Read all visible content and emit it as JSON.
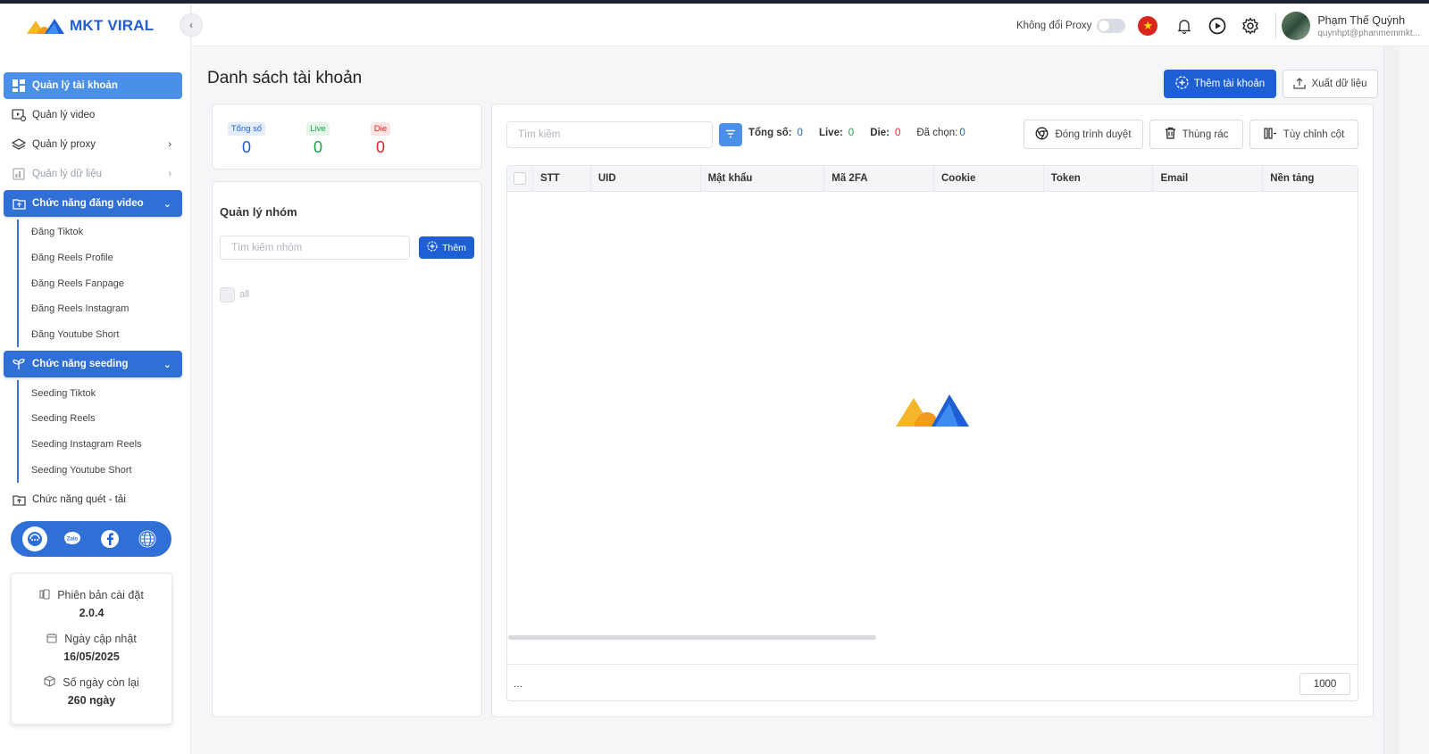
{
  "brand": {
    "name": "MKT VIRAL",
    "primary_color": "#1e5fd6",
    "accent_color": "#4a8fe8"
  },
  "header": {
    "proxy_label": "Không đổi Proxy",
    "user_name": "Phạm Thế Quỳnh",
    "user_email": "quynhpt@phanmemmkt..."
  },
  "sidebar": {
    "items": [
      {
        "label": "Quản lý tài khoản",
        "icon": "grid-icon"
      },
      {
        "label": "Quản lý video",
        "icon": "video-icon"
      },
      {
        "label": "Quản lý proxy",
        "icon": "layers-icon"
      },
      {
        "label": "Quản lý dữ liệu",
        "icon": "chart-icon"
      }
    ],
    "video_section": {
      "label": "Chức năng đăng video",
      "items": [
        "Đăng Tiktok",
        "Đăng Reels Profile",
        "Đăng Reels Fanpage",
        "Đăng Reels Instagram",
        "Đăng Youtube Short"
      ]
    },
    "seeding_section": {
      "label": "Chức năng seeding",
      "items": [
        "Seeding Tiktok",
        "Seeding Reels",
        "Seeding Instagram Reels",
        "Seeding Youtube Short"
      ]
    },
    "scan_label": "Chức năng quét - tải",
    "info": {
      "version_label": "Phiên bản cài đặt",
      "version_value": "2.0.4",
      "update_label": "Ngày cập nhật",
      "update_value": "16/05/2025",
      "days_label": "Số ngày còn lại",
      "days_value": "260 ngày"
    }
  },
  "main": {
    "title": "Danh sách tài khoản",
    "add_account_label": "Thêm tài khoản",
    "export_label": "Xuất dữ liệu",
    "stats": [
      {
        "label": "Tổng số",
        "value": "0",
        "color": "#1e5fd6"
      },
      {
        "label": "Live",
        "value": "0",
        "color": "#1aa34a"
      },
      {
        "label": "Die",
        "value": "0",
        "color": "#e02424"
      }
    ],
    "group": {
      "title": "Quản lý nhóm",
      "search_placeholder": "Tìm kiếm nhóm",
      "add_label": "Thêm",
      "all_label": "all"
    },
    "toolbar": {
      "search_placeholder": "Tìm kiếm",
      "total_label": "Tổng số:",
      "total_value": "0",
      "live_label": "Live:",
      "live_value": "0",
      "die_label": "Die:",
      "die_value": "0",
      "selected_label": "Đã chọn:",
      "selected_value": "0",
      "close_browser_label": "Đóng trình duyệt",
      "trash_label": "Thùng rác",
      "columns_label": "Tùy chỉnh cột"
    },
    "table": {
      "columns": [
        "STT",
        "UID",
        "Mật khẩu",
        "Mã 2FA",
        "Cookie",
        "Token",
        "Email",
        "Nền tảng"
      ],
      "footer_ellipsis": "...",
      "page_size": "1000"
    }
  }
}
